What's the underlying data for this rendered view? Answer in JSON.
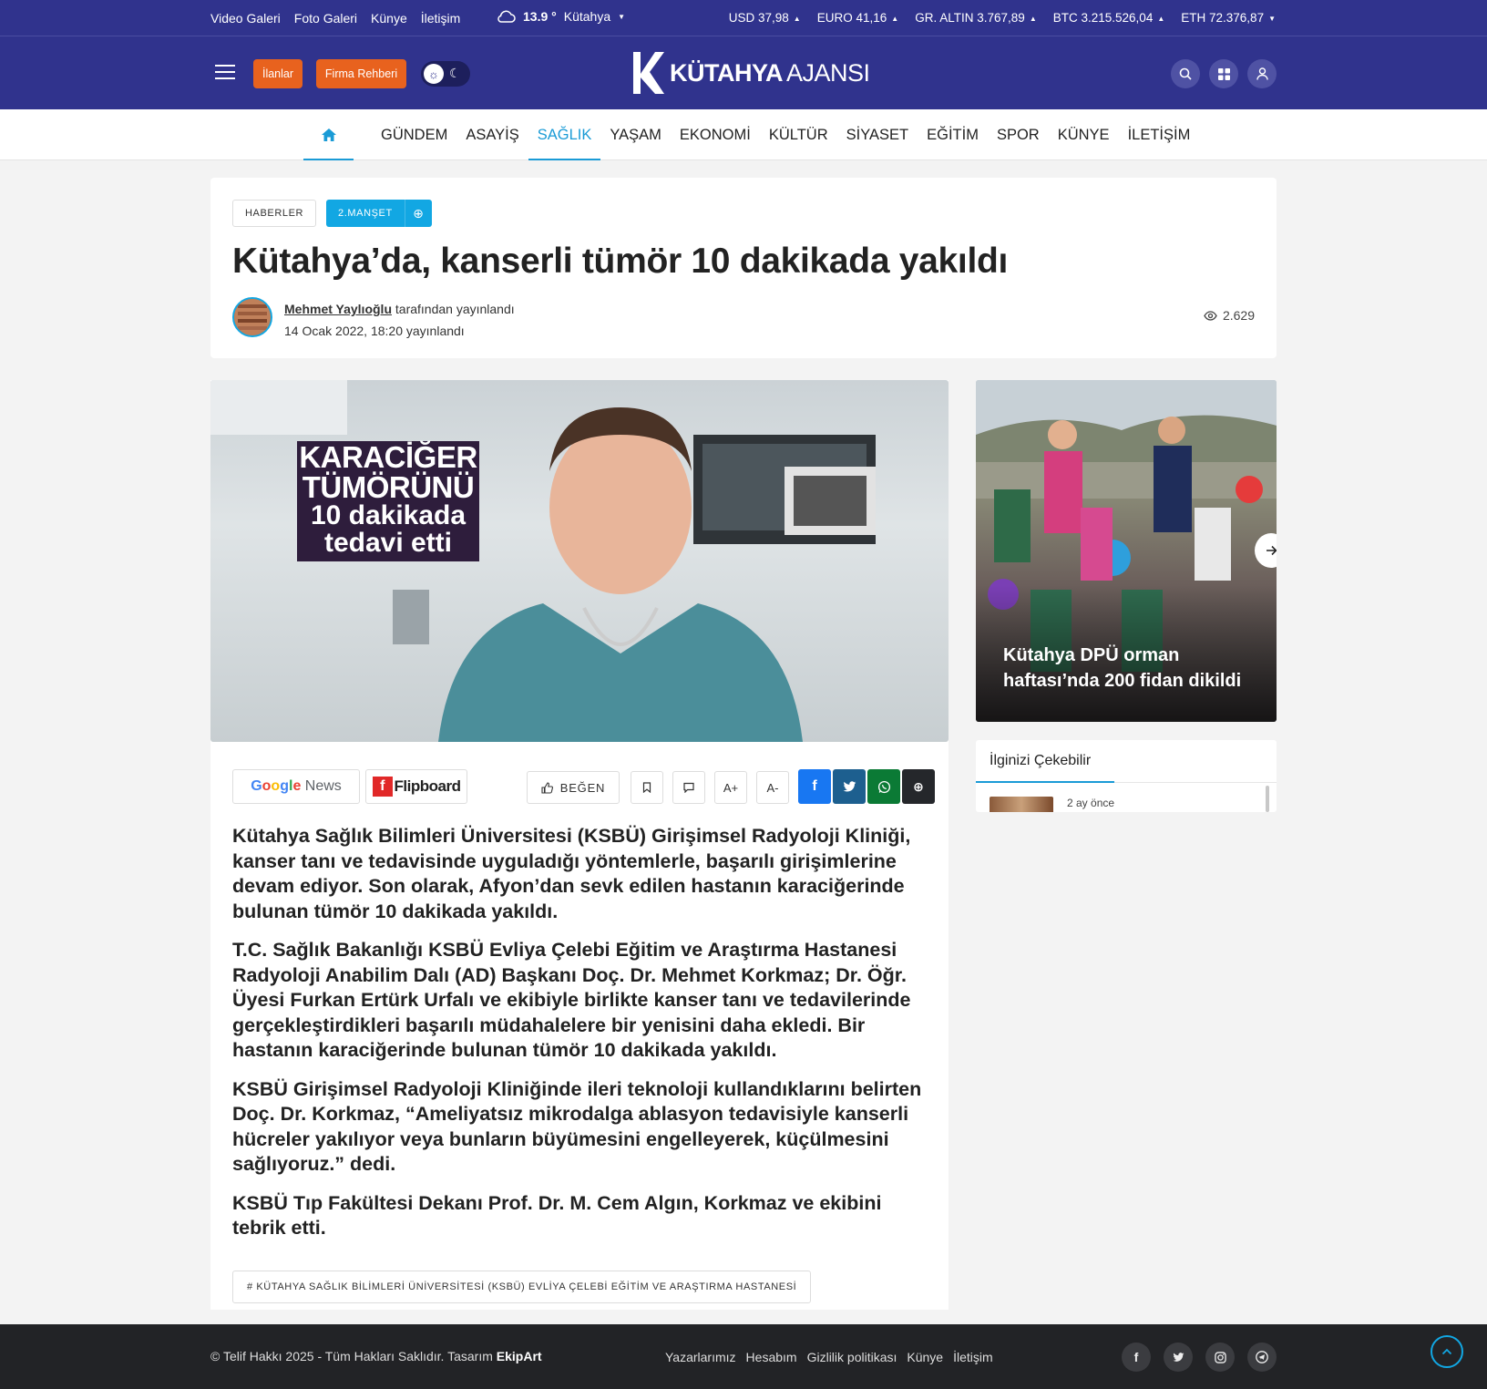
{
  "topbar": {
    "links": [
      "Video Galeri",
      "Foto Galeri",
      "Künye",
      "İletişim"
    ],
    "weather": {
      "temp": "13.9 °",
      "city": "Kütahya"
    },
    "rates": [
      {
        "label": "USD",
        "value": "37,98"
      },
      {
        "label": "EURO",
        "value": "41,16"
      },
      {
        "label": "GR. ALTIN",
        "value": "3.767,89"
      },
      {
        "label": "BTC",
        "value": "3.215.526,04"
      },
      {
        "label": "ETH",
        "value": "72.376,87"
      }
    ]
  },
  "header": {
    "ilanlar_label": "İlanlar",
    "firma_label": "Firma Rehberi",
    "logo_bold": "KÜTAHYA",
    "logo_light": "AJANSI"
  },
  "nav": {
    "items": [
      "GÜNDEM",
      "ASAYİŞ",
      "SAĞLIK",
      "YAŞAM",
      "EKONOMİ",
      "KÜLTÜR",
      "SİYASET",
      "EĞİTİM",
      "SPOR",
      "KÜNYE",
      "İLETİŞİM"
    ],
    "active": "SAĞLIK"
  },
  "article": {
    "category": "HABERLER",
    "tag": "2.MANŞET",
    "title": "Kütahya’da, kanserli tümör 10 dakikada yakıldı",
    "author": "Mehmet Yaylıoğlu",
    "author_suffix": "tarafından yayınlandı",
    "date": "14 Ocak 2022, 18:20 yayınlandı",
    "views": "2.629",
    "hero_overlay": [
      "KARACİĞER",
      "TÜMÖRÜNÜ",
      "10 dakikada",
      "tedavi etti"
    ],
    "paragraphs": [
      "Kütahya Sağlık Bilimleri Üniversitesi (KSBÜ) Girişimsel Radyoloji Kliniği, kanser tanı ve tedavisinde uyguladığı yöntemlerle, başarılı girişimlerine devam ediyor. Son olarak, Afyon’dan sevk edilen hastanın karaciğerinde bulunan tümör 10 dakikada yakıldı.",
      "T.C. Sağlık Bakanlığı KSBÜ Evliya Çelebi Eğitim ve Araştırma Hastanesi Radyoloji Anabilim Dalı (AD) Başkanı Doç. Dr. Mehmet Korkmaz; Dr. Öğr. Üyesi Furkan Ertürk Urfalı ve ekibiyle birlikte kanser tanı ve tedavilerinde gerçekleştirdikleri başarılı müdahalelere bir yenisini daha ekledi. Bir hastanın karaciğerinde bulunan tümör 10 dakikada yakıldı.",
      "KSBÜ Girişimsel Radyoloji Kliniğinde ileri teknoloji kullandıklarını belirten Doç. Dr. Korkmaz, “Ameliyatsız mikrodalga ablasyon tedavisiyle kanserli hücreler yakılıyor veya bunların büyümesini engelleyerek, küçülmesini sağlıyoruz.” dedi.",
      "KSBÜ Tıp Fakültesi Dekanı Prof. Dr. M. Cem Algın, Korkmaz ve ekibini tebrik etti."
    ],
    "hashtag": "# KÜTAHYA SAĞLIK BİLİMLERİ ÜNİVERSİTESİ (KSBÜ) EVLİYA ÇELEBİ EĞİTİM VE ARAŞTIRMA HASTANESİ"
  },
  "toolbar": {
    "google_g": "Google",
    "google_news": "News",
    "flipboard": "Flipboard",
    "like": "BEĞEN",
    "font_up": "A+",
    "font_down": "A-"
  },
  "sidebar": {
    "slider_title": "Kütahya DPÜ orman haftası’nda 200 fidan dikildi",
    "related_title": "İlginizi Çekebilir",
    "related_time": "2 ay önce"
  },
  "footer": {
    "copy": "© Telif Hakkı 2025 - Tüm Hakları Saklıdır. Tasarım",
    "designer": "EkipArt",
    "links": [
      "Yazarlarımız",
      "Hesabım",
      "Gizlilik politikası",
      "Künye",
      "İletişim"
    ]
  },
  "colors": {
    "brand": "#30338d",
    "accent": "#12a7e3",
    "orange": "#e8621e",
    "facebook": "#1877f2",
    "twitter": "#1d5f8f",
    "whatsapp": "#0b7a35",
    "share": "#25272b"
  }
}
